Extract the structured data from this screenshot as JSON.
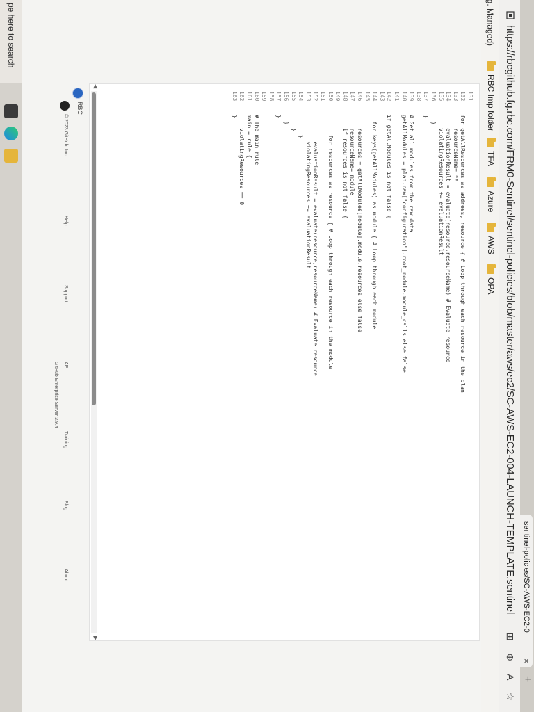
{
  "browser": {
    "tab_title": "sentinel-policies/SC-AWS-EC2-0",
    "tab_close": "×",
    "new_tab": "+",
    "url": "https://rbcgithub.fg.rbc.com/FRM0-Sentinel/sentinel-policies/blob/master/aws/ec2/SC-AWS-EC2-004-LAUNCH-TEMPLATE.sentinel",
    "icons": [
      "split-screen-icon",
      "zoom-icon",
      "read-aloud-icon",
      "favorite-star-icon"
    ]
  },
  "bookmarks": {
    "left_partial": "ng. Managed)",
    "items": [
      "RBC Imp folder",
      "TFA",
      "Azure",
      "AWS",
      "OPA"
    ]
  },
  "code": {
    "lines": [
      {
        "num": "131",
        "text": ""
      },
      {
        "num": "132",
        "text": "for getAllResources as address, resource { # Loop through each resource in the plan"
      },
      {
        "num": "133",
        "text": "    resourceName= **"
      },
      {
        "num": "134",
        "text": "    evaluationResult = evaluate(resource,resourceName) # Evaluate resource"
      },
      {
        "num": "135",
        "text": "    violatingResources += evaluationResult"
      },
      {
        "num": "136",
        "text": "  }"
      },
      {
        "num": "137",
        "text": "}"
      },
      {
        "num": "138",
        "text": ""
      },
      {
        "num": "139",
        "text": "# Get all modules from the raw data"
      },
      {
        "num": "140",
        "text": "getAllModules = plan.raw[\"configuration\"].root_module.module_calls else false"
      },
      {
        "num": "141",
        "text": ""
      },
      {
        "num": "142",
        "text": "if getAllModules is not false {"
      },
      {
        "num": "143",
        "text": ""
      },
      {
        "num": "144",
        "text": "  for keys(getAllModules) as module { # Loop through each module"
      },
      {
        "num": "145",
        "text": ""
      },
      {
        "num": "146",
        "text": "    resources = getAllModules[module].module.resources else false"
      },
      {
        "num": "147",
        "text": "    resourceName= module"
      },
      {
        "num": "148",
        "text": "    if resources is not false {"
      },
      {
        "num": "149",
        "text": ""
      },
      {
        "num": "150",
        "text": "      for resources as resource { # Loop through each resource in the module"
      },
      {
        "num": "151",
        "text": ""
      },
      {
        "num": "152",
        "text": "        evaluationResult = evaluate(resource,resourceName) # Evaluate resource"
      },
      {
        "num": "153",
        "text": "        violatingResources += evaluationResult"
      },
      {
        "num": "154",
        "text": "      }"
      },
      {
        "num": "155",
        "text": "    }"
      },
      {
        "num": "156",
        "text": "  }"
      },
      {
        "num": "157",
        "text": "}"
      },
      {
        "num": "158",
        "text": ""
      },
      {
        "num": "159",
        "text": ""
      },
      {
        "num": "160",
        "text": "# The main rule"
      },
      {
        "num": "161",
        "text": "main = rule {"
      },
      {
        "num": "162",
        "text": "    violatingResources == 0"
      },
      {
        "num": "163",
        "text": "}"
      }
    ]
  },
  "footer": {
    "org": "RBC",
    "copyright": "© 2023 GitHub, Inc.",
    "links": [
      "Help",
      "Support",
      "API",
      "Training",
      "Blog",
      "About"
    ],
    "server": "GitHub Enterprise Server 3.9.4"
  },
  "taskbar": {
    "search_placeholder": "pe here to search"
  }
}
